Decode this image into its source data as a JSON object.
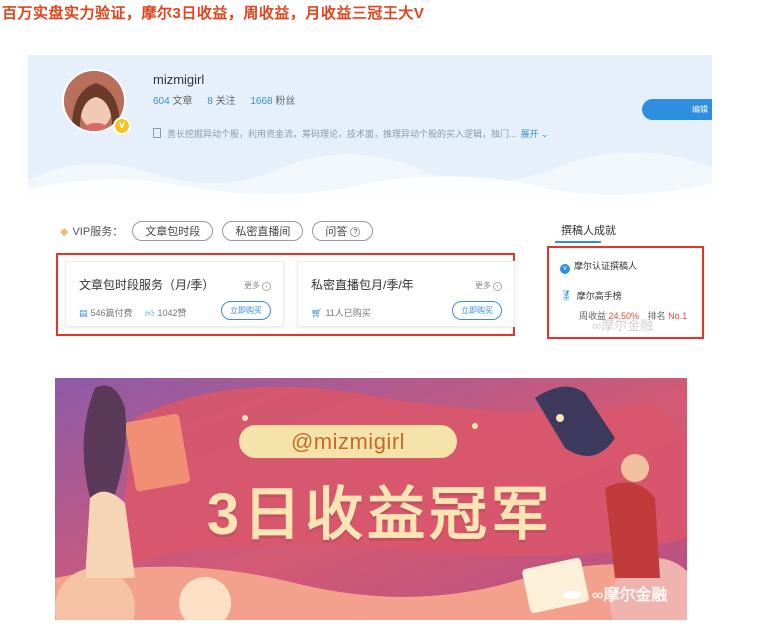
{
  "headline": "百万实盘实力验证，摩尔3日收益，周收益，月收益三冠王大V",
  "profile": {
    "username": "mizmigirl",
    "articles_count": "604",
    "articles_label": "文章",
    "following_count": "8",
    "following_label": "关注",
    "followers_count": "1668",
    "followers_label": "粉丝",
    "intro": "善长挖掘异动个股，利用资金流，筹码理论，技术面，推理异动个股的买入逻辑，独门...",
    "expand_label": "展开",
    "edit_label": "编辑"
  },
  "vip": {
    "label": "VIP服务：",
    "pills": [
      "文章包时段",
      "私密直播间",
      "问答"
    ]
  },
  "cards": [
    {
      "title": "文章包时段服务（月/季）",
      "more": "更多",
      "meta1": "546篇付费",
      "meta2": "1042赞",
      "buy": "立即购买"
    },
    {
      "title": "私密直播包月/季/年",
      "more": "更多",
      "meta1": "11人已购买",
      "meta2": "",
      "buy": "立即购买"
    }
  ],
  "achievements": {
    "tab_label": "撰稿人成就",
    "certified": "摩尔认证撰稿人",
    "ranking": "摩尔高手榜",
    "weekly_label": "周收益",
    "weekly_value": "24.50%",
    "rank_label": "排名",
    "rank_value": "No.1",
    "watermark": "摩尔金融"
  },
  "banner": {
    "handle": "@mizmigirl",
    "title": "3日收益冠军",
    "watermark": "摩尔金融"
  },
  "colors": {
    "headline": "#e0431d",
    "accent_blue": "#2e8fe0",
    "highlight_box": "#e8332b",
    "banner_bg": "#d9566b"
  }
}
